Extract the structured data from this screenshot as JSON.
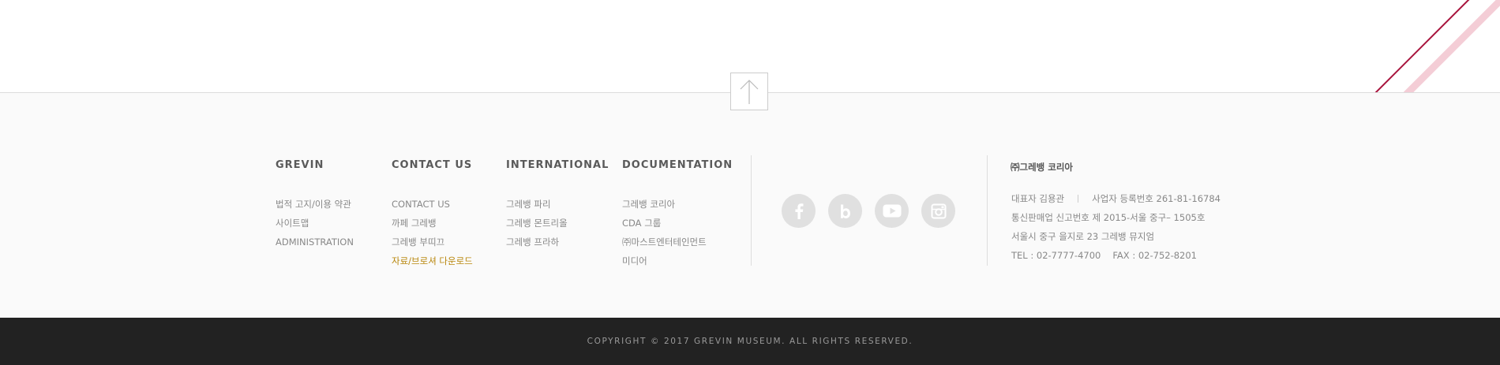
{
  "footer_columns": [
    {
      "title": "GREVIN",
      "items": [
        "법적 고지/이용 약관",
        "사이트맵",
        "ADMINISTRATION"
      ]
    },
    {
      "title": "CONTACT US",
      "items": [
        "CONTACT US",
        "까페 그레뱅",
        "그레뱅 부띠끄",
        "자료/브로셔 다운로드"
      ]
    },
    {
      "title": "INTERNATIONAL",
      "items": [
        "그레뱅 파리",
        "그레뱅 몬트리올",
        "그레뱅 프라하"
      ]
    },
    {
      "title": "DOCUMENTATION",
      "items": [
        "그레뱅 코리아",
        "CDA 그룹",
        "㈜마스트엔터테인먼트",
        "미디어"
      ]
    }
  ],
  "highlight_color": "#b8860b",
  "social": [
    {
      "icon": "facebook-icon",
      "glyph": "f"
    },
    {
      "icon": "blog-icon",
      "glyph": "b"
    },
    {
      "icon": "youtube-icon"
    },
    {
      "icon": "instagram-icon"
    }
  ],
  "company": {
    "name": "㈜그레뱅 코리아",
    "ceo": "대표자 김용관",
    "biz_reg": "사업자 등록번호 261-81-16784",
    "mail_order": "통신판매업 신고번호 제 2015-서울 중구– 1505호",
    "address": "서울시 중구 을지로 23 그레뱅 뮤지엄",
    "tel": "TEL : 02-7777-4700",
    "fax": "FAX : 02-752-8201"
  },
  "copyright": "COPYRIGHT © 2017 GREVIN MUSEUM. ALL RIGHTS RESERVED.",
  "colors": {
    "deco_dark_line": "#a8133c",
    "deco_light_line": "#f4cdd6",
    "bottom_bar": "#222222"
  }
}
